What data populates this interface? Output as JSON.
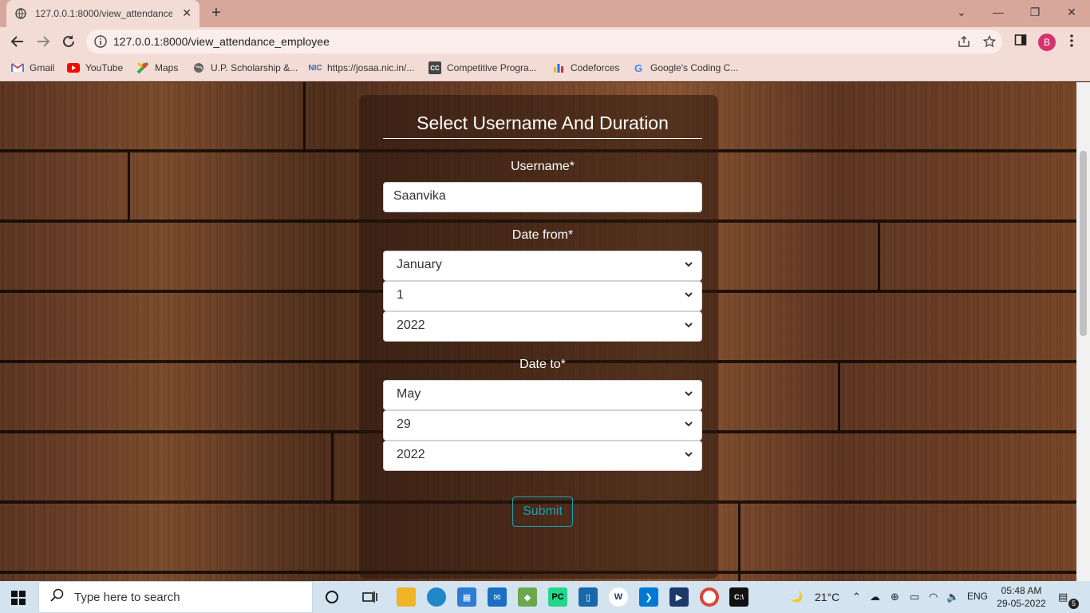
{
  "browser": {
    "tab_title": "127.0.0.1:8000/view_attendance_",
    "url": "127.0.0.1:8000/view_attendance_employee",
    "profile_initial": "B",
    "bookmarks": [
      {
        "label": "Gmail",
        "icon": "gmail-icon"
      },
      {
        "label": "YouTube",
        "icon": "youtube-icon"
      },
      {
        "label": "Maps",
        "icon": "maps-icon"
      },
      {
        "label": "U.P. Scholarship &...",
        "icon": "globe-icon"
      },
      {
        "label": "https://josaa.nic.in/...",
        "icon": "nic-icon"
      },
      {
        "label": "Competitive Progra...",
        "icon": "cc-icon"
      },
      {
        "label": "Codeforces",
        "icon": "codeforces-icon"
      },
      {
        "label": "Google's Coding C...",
        "icon": "google-icon"
      }
    ]
  },
  "form": {
    "title": "Select Username And Duration",
    "username_label": "Username*",
    "username_value": "Saanvika",
    "date_from_label": "Date from*",
    "date_from": {
      "month": "January",
      "day": "1",
      "year": "2022"
    },
    "date_to_label": "Date to*",
    "date_to": {
      "month": "May",
      "day": "29",
      "year": "2022"
    },
    "submit_label": "Submit"
  },
  "taskbar": {
    "search_placeholder": "Type here to search",
    "weather": "21°C",
    "language": "ENG",
    "time": "05:48 AM",
    "date": "29-05-2022",
    "notification_count": "5"
  },
  "colors": {
    "tabstrip": "#d7a79c",
    "toolbar": "#f4dcd6",
    "submit_accent": "#17a2b8"
  }
}
